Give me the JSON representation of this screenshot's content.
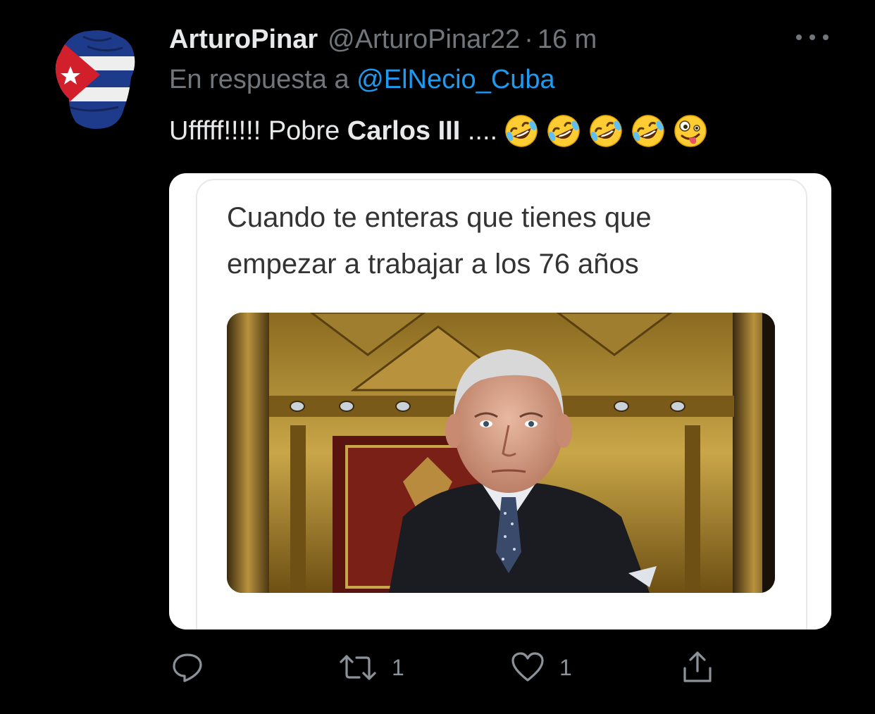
{
  "tweet": {
    "display_name": "ArturoPinar",
    "handle": "@ArturoPinar22",
    "separator": "·",
    "time": "16 m",
    "reply_prefix": "En respuesta a",
    "reply_to": "@ElNecio_Cuba",
    "text_start": "Ufffff!!!!! Pobre",
    "text_bold": "Carlos III",
    "text_end": "....",
    "emojis": [
      "rolling-on-floor-laughing",
      "rolling-on-floor-laughing",
      "rolling-on-floor-laughing",
      "rolling-on-floor-laughing",
      "zany-face"
    ]
  },
  "media": {
    "caption": "Cuando te enteras que tienes que empezar a trabajar a los 76 años"
  },
  "actions": {
    "reply_count": "",
    "retweet_count": "1",
    "like_count": "1"
  },
  "colors": {
    "background": "#000000",
    "link": "#1d9bf0",
    "muted": "#71767b",
    "text": "#e7e9ea"
  }
}
